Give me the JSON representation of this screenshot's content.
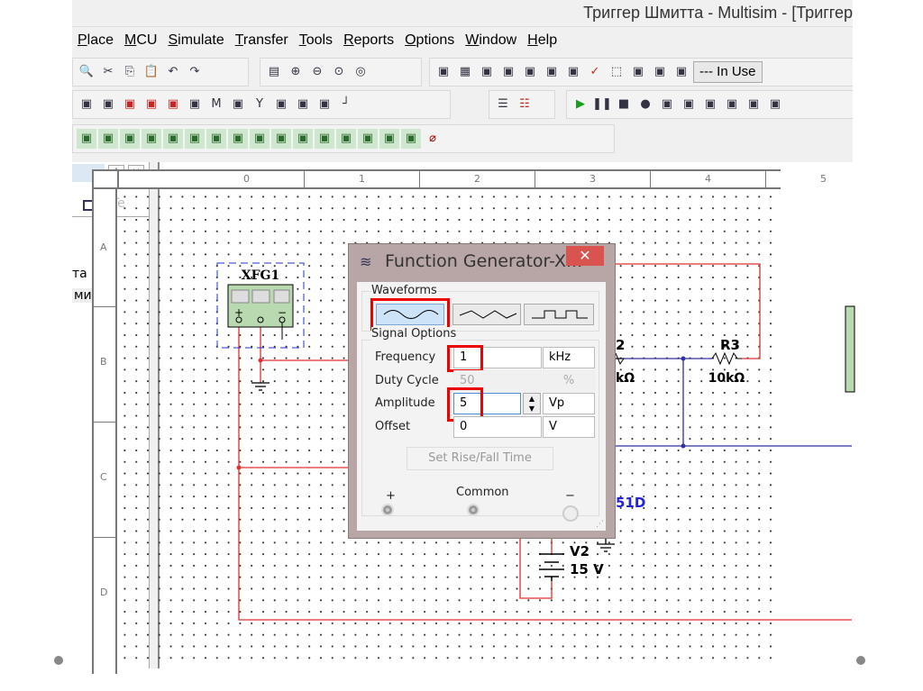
{
  "window": {
    "title": "Триггер Шмитта - Multisim - [Триггер"
  },
  "menu": [
    "Place",
    "MCU",
    "Simulate",
    "Transfer",
    "Tools",
    "Reports",
    "Options",
    "Window",
    "Help"
  ],
  "toolbar1a": [
    "print-preview-icon",
    "cut-icon",
    "copy-icon",
    "paste-icon",
    "undo-icon",
    "redo-icon"
  ],
  "toolbar1b": [
    "full-screen-icon",
    "zoom-in-icon",
    "zoom-out-icon",
    "zoom-area-icon",
    "zoom-fit-icon"
  ],
  "toolbar1c": [
    "design-toolbox-icon",
    "spreadsheet-icon",
    "database-icon",
    "component-wizard-icon",
    "postprocessor-icon",
    "grapher-icon",
    "bom-icon",
    "erc-icon",
    "selection-icon",
    "replace-icon",
    "back-annotate-icon",
    "forward-annotate-icon"
  ],
  "in_use": "--- In Use",
  "toolbar2a": [
    "ttl-icon",
    "cmos-icon",
    "mixed-icon",
    "indicator-icon",
    "misc-digital-icon",
    "power-icon",
    "misc-icon",
    "advanced-peripherals-icon",
    "rf-icon",
    "electromechanical-icon",
    "mcu-icon",
    "hierarchical-block-icon",
    "bus-icon"
  ],
  "toolbar2b": [
    "ladder-icon",
    "ladder-rungs-icon"
  ],
  "toolbar2c": [
    "run-icon",
    "pause-icon",
    "stop-icon",
    "breakpoint-icon",
    "step-into-icon",
    "step-over-icon",
    "step-out-icon",
    "run-to-cursor-icon",
    "toggle-breakpoint-icon",
    "remove-breakpoints-icon"
  ],
  "toolbar3": [
    "multimeter-icon",
    "function-generator-icon",
    "wattmeter-icon",
    "oscilloscope-icon",
    "four-channel-oscilloscope-icon",
    "bode-plotter-icon",
    "frequency-counter-icon",
    "word-generator-icon",
    "logic-converter-icon",
    "logic-analyzer-icon",
    "iv-analyzer-icon",
    "distortion-analyzer-icon",
    "spectrum-analyzer-icon",
    "probe-icon",
    "labview-icon",
    "tektronix-icon",
    "current-probe-icon"
  ],
  "left_panel": {
    "item1": "та",
    "item2": "митта"
  },
  "rulers": {
    "top": [
      "0",
      "1",
      "2",
      "3",
      "4",
      "5"
    ],
    "left": [
      "A",
      "B",
      "C",
      "D"
    ]
  },
  "circuit": {
    "xfg_label": "XFG1",
    "r2_label": "2",
    "r2_value": "kΩ",
    "r3_label": "R3",
    "r3_value": "10kΩ",
    "opamp_label": "51D",
    "v2_label": "V2",
    "v2_value": "15 V",
    "xfg_plus": "+",
    "xfg_minus": "−"
  },
  "dialog": {
    "title": "Function Generator-X...",
    "close": "✕",
    "waveforms_label": "Waveforms",
    "waveforms": [
      "sine",
      "triangle",
      "square"
    ],
    "selected_waveform": "sine",
    "signal_options_label": "Signal Options",
    "rows": [
      {
        "label": "Frequency",
        "value": "1",
        "unit": "kHz",
        "disabled": false
      },
      {
        "label": "Duty Cycle",
        "value": "50",
        "unit": "%",
        "disabled": true
      },
      {
        "label": "Amplitude",
        "value": "5",
        "unit": "Vp",
        "disabled": false
      },
      {
        "label": "Offset",
        "value": "0",
        "unit": "V",
        "disabled": false
      }
    ],
    "rise_fall_button": "Set Rise/Fall Time",
    "terminals": {
      "plus": "+",
      "common": "Common",
      "minus": "−"
    }
  },
  "colors": {
    "highlight": "#e00000",
    "wire_red": "#e03030",
    "wire_blue": "#3030a0",
    "close": "#d9534f"
  }
}
